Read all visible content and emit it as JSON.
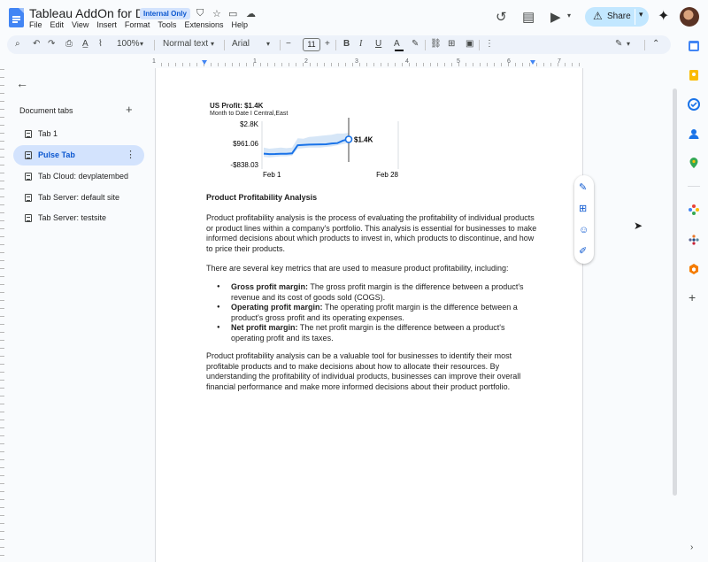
{
  "header": {
    "title": "Tableau AddOn for Docs",
    "badge": "Internal Only",
    "menus": [
      "File",
      "Edit",
      "View",
      "Insert",
      "Format",
      "Tools",
      "Extensions",
      "Help"
    ],
    "share_label": "Share"
  },
  "toolbar": {
    "zoom": "100%",
    "style": "Normal text",
    "font": "Arial",
    "font_size": "11"
  },
  "ruler": {
    "numbers": [
      "1",
      "1",
      "2",
      "3",
      "4",
      "5",
      "6",
      "7"
    ]
  },
  "sidebar": {
    "heading": "Document tabs",
    "tabs": [
      {
        "label": "Tab 1",
        "active": false
      },
      {
        "label": "Pulse Tab",
        "active": true
      },
      {
        "label": "Tab Cloud: devplatembed",
        "active": false
      },
      {
        "label": "Tab Server: default site",
        "active": false
      },
      {
        "label": "Tab Server: testsite",
        "active": false
      }
    ]
  },
  "chart_data": {
    "type": "line",
    "title": "US Profit: $1.4K",
    "subtitle": "Month to Date I Central,East",
    "y_tick_labels": [
      "$2.8K",
      "$961.06",
      "-$838.03"
    ],
    "x_tick_labels": [
      "Feb 1",
      "Feb 28"
    ],
    "current_value_label": "$1.4K",
    "x": [
      1,
      2,
      3,
      4,
      5,
      6,
      7,
      8,
      9,
      10,
      11,
      12,
      13,
      14,
      15,
      16
    ],
    "values": [
      180,
      140,
      150,
      170,
      160,
      200,
      900,
      920,
      950,
      960,
      970,
      980,
      1050,
      1080,
      1300,
      1400
    ],
    "band_upper": [
      700,
      600,
      650,
      700,
      650,
      700,
      1500,
      1450,
      1600,
      1650,
      1700,
      1750,
      1800,
      1900,
      1900,
      1950
    ],
    "band_lower": [
      -100,
      -150,
      -100,
      -50,
      -50,
      0,
      600,
      650,
      700,
      700,
      700,
      750,
      800,
      900,
      1000,
      1100
    ],
    "ylim": [
      -838.03,
      2800
    ],
    "colors": {
      "line": "#1a73e8",
      "band": "#d6e6f7",
      "marker": "#1a73e8"
    }
  },
  "document": {
    "heading": "Product Profitability Analysis",
    "para1": "Product profitability analysis is the process of evaluating the profitability of individual products or product lines within a company's portfolio. This analysis is essential for businesses to make informed decisions about which products to invest in, which products to discontinue, and how to price their products.",
    "para2": "There are several key metrics that are used to measure product profitability, including:",
    "bullets": [
      {
        "term": "Gross profit margin:",
        "text": " The gross profit margin is the difference between a product's revenue and its cost of goods sold (COGS)."
      },
      {
        "term": "Operating profit margin:",
        "text": " The operating profit margin is the difference between a product's gross profit and its operating expenses."
      },
      {
        "term": "Net profit margin:",
        "text": " The net profit margin is the difference between a product's operating profit and its taxes."
      }
    ],
    "para3": "Product profitability analysis can be a valuable tool for businesses to identify their most profitable products and to make decisions about how to allocate their resources. By understanding the profitability of individual products, businesses can improve their overall financial performance and make more informed decisions about their product portfolio."
  }
}
